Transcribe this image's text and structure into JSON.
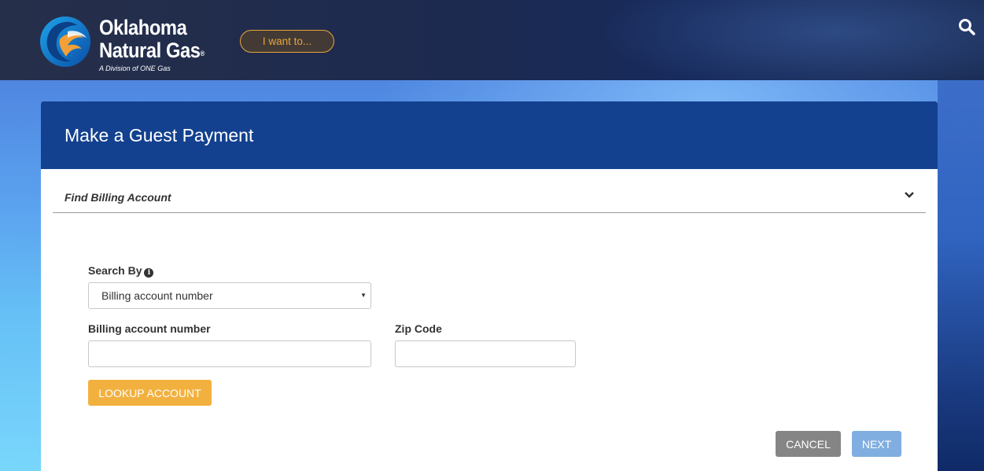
{
  "header": {
    "logo": {
      "line1": "Oklahoma",
      "line2": "Natural Gas",
      "reg": "®",
      "sub": "A Division of ONE Gas"
    },
    "i_want_to_label": "I want to...",
    "search_icon": "search-icon"
  },
  "panel": {
    "title": "Make a Guest Payment",
    "section": {
      "title": "Find Billing Account",
      "toggle_icon": "chevron-down-icon"
    },
    "form": {
      "search_by_label": "Search By",
      "info_icon": "info-icon",
      "search_by_value": "Billing account number",
      "billing_account_label": "Billing account number",
      "billing_account_value": "",
      "zip_label": "Zip Code",
      "zip_value": "",
      "lookup_label": "LOOKUP ACCOUNT"
    },
    "actions": {
      "cancel_label": "CANCEL",
      "next_label": "NEXT"
    }
  },
  "colors": {
    "header_bg": "#1d2a4f",
    "panel_head": "#13418f",
    "accent_orange": "#f2b13f",
    "cancel_gray": "#858585",
    "next_blue": "#80aee0"
  }
}
